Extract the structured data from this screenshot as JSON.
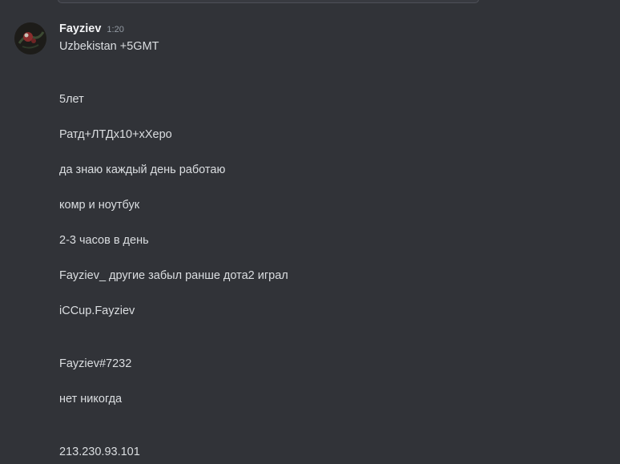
{
  "message": {
    "author": "Fayziev",
    "timestamp": "1:20",
    "avatar_icon": "avatar-image",
    "lines": [
      "Uzbekistan +5GMT",
      "5лет",
      "Ратд+ЛТДх10+хХеро",
      "да знаю каждый день работаю",
      "комр и ноутбук",
      "2-3 часов в день",
      "Fayziev_ другие забыл ранше дота2 играл",
      "iCCup.Fayziev",
      "Fayziev#7232",
      "нет никогда",
      "213.230.93.101"
    ]
  },
  "colors": {
    "background": "#313338",
    "text": "#dbdee1",
    "username": "#f2f3f5",
    "timestamp": "#949ba4"
  }
}
